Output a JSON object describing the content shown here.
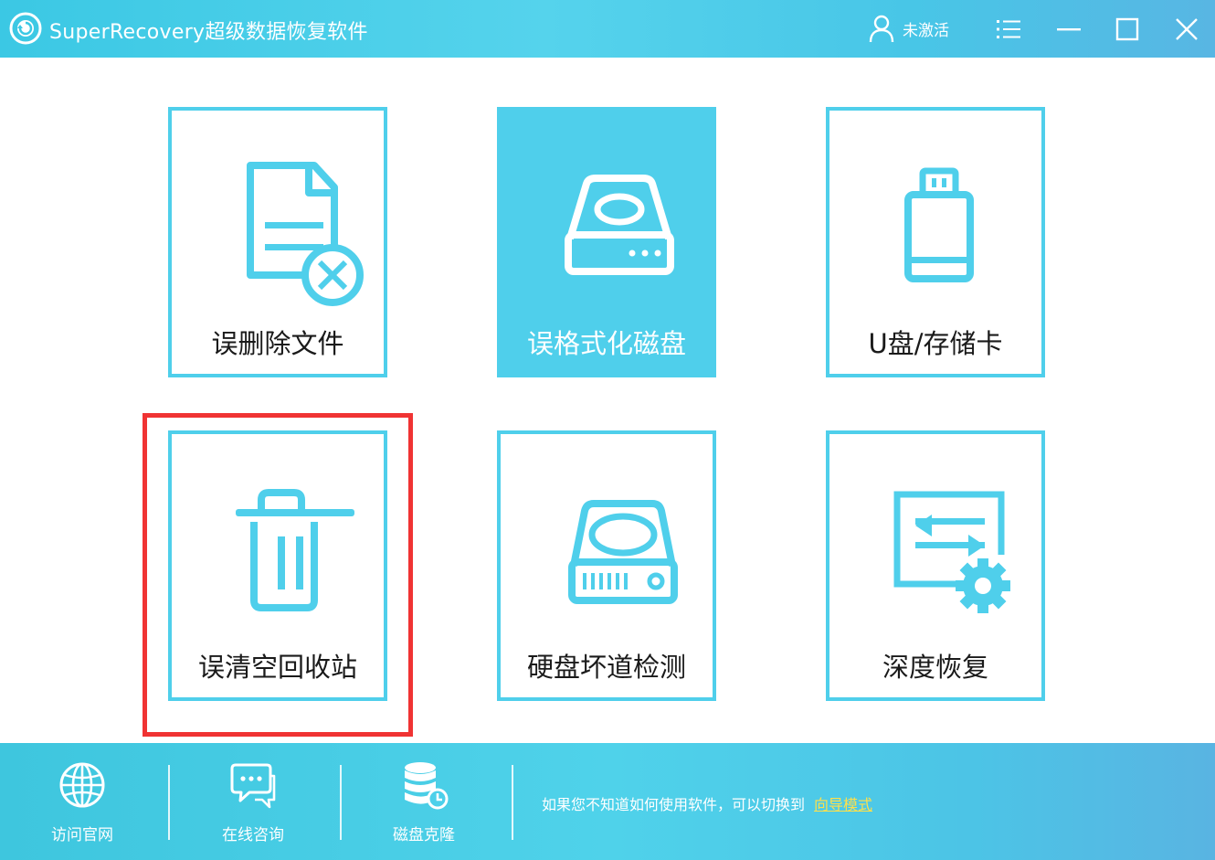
{
  "window": {
    "title": "SuperRecovery超级数据恢复软件",
    "user_status": "未激活"
  },
  "tiles": [
    {
      "label": "误删除文件",
      "icon": "deleted-file-icon",
      "active": false
    },
    {
      "label": "误格式化磁盘",
      "icon": "disk-drive-icon",
      "active": true
    },
    {
      "label": "U盘/存储卡",
      "icon": "usb-drive-icon",
      "active": false
    },
    {
      "label": "误清空回收站",
      "icon": "trash-bin-icon",
      "active": false,
      "highlighted": true
    },
    {
      "label": "硬盘坏道检测",
      "icon": "hard-disk-icon",
      "active": false
    },
    {
      "label": "深度恢复",
      "icon": "deep-recovery-icon",
      "active": false
    }
  ],
  "bottom": {
    "items": [
      {
        "label": "访问官网",
        "icon": "globe-icon"
      },
      {
        "label": "在线咨询",
        "icon": "chat-icon"
      },
      {
        "label": "磁盘克隆",
        "icon": "database-clone-icon"
      }
    ],
    "hint_text": "如果您不知道如何使用软件，可以切换到",
    "hint_link": "向导模式"
  },
  "colors": {
    "accent": "#4fcfeb",
    "highlight": "#f03333",
    "link": "#ffe04a"
  }
}
